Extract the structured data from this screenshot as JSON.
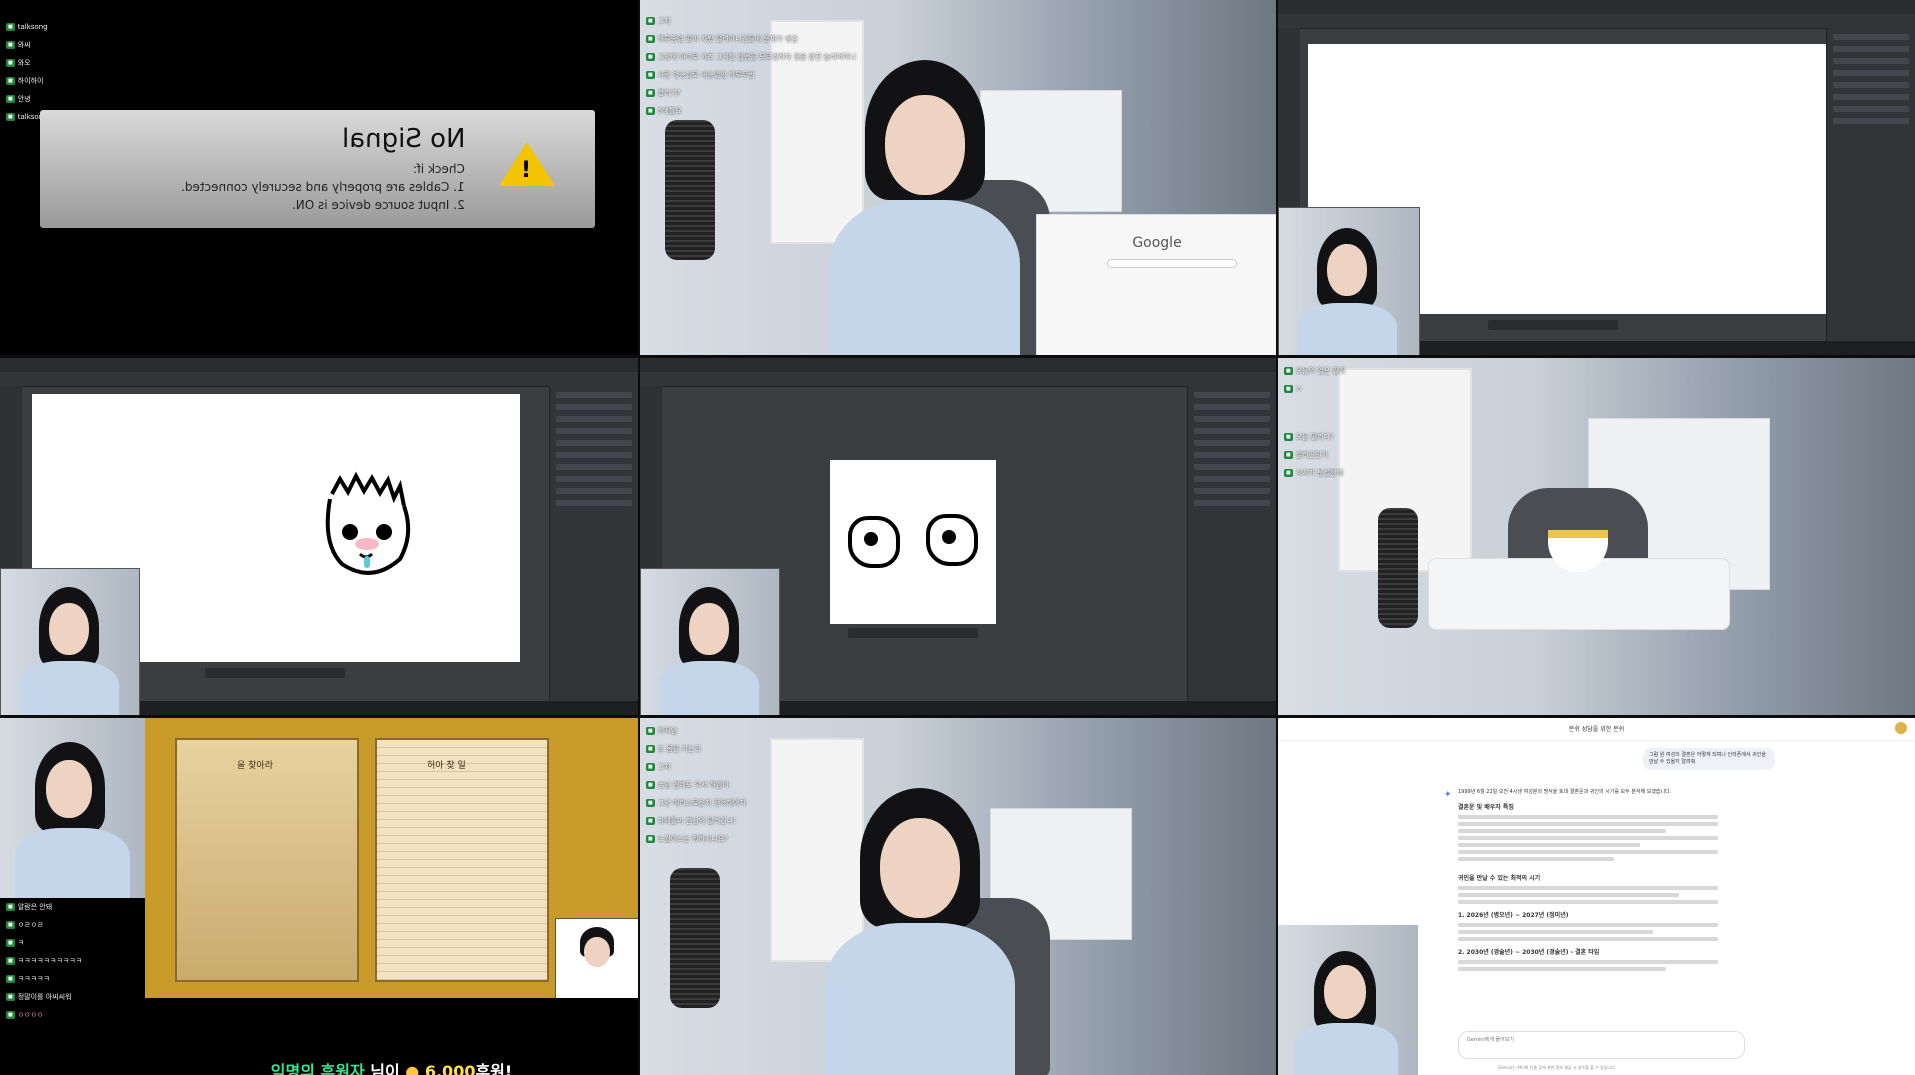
{
  "tile1": {
    "chat": [
      "talksong",
      "와씨",
      "와오",
      "하이하이",
      "안녕",
      "talksong"
    ],
    "no_signal": {
      "title": "No Signal",
      "check": "Check if:",
      "line1": "1. Cables are properly and securely connected.",
      "line2": "2. Input source device is ON."
    }
  },
  "tile2": {
    "chat": [
      "그치",
      "하루종일 딸이 자봤 딸려아니긴들에 둔재가 생김",
      "그냥에 아이로 가즈 그게한 한번을 모르겐하자 정을 완전 놀리어아니",
      "사랑 방송실로 내송일임 하루두번",
      "합리기?",
      "5예월요"
    ],
    "google": "Google"
  },
  "tile7": {
    "chat": [
      "알람은 안돼",
      "ㅇㄹㅇㄹ",
      "ㅋ",
      "ㅋㅋㅋㅋㅋㅋㅋㅋㅋㅋ",
      "ㅋㅋㅋㅋㅋ",
      "정말이를 아씨씨워",
      "ㅇㅇㅇㅇ"
    ],
    "donation": {
      "prefix": "익명의 후원자",
      "mid": "님이",
      "amount": "6,000",
      "suffix": "후원!"
    },
    "book_left_title": "을 찾아라",
    "book_right_title": "허아 찾 일"
  },
  "tile6": {
    "chat": [
      "오늘의 일은 필쥐",
      "ㅇ",
      "오늘 딸리다?",
      "셀리긴인가",
      "식사가 분실한데"
    ]
  },
  "tile8": {
    "chat": [
      "회작임",
      "또 몸을 키는것",
      "그치",
      "손님 엔메도 우서 하임이",
      "그냥 예라스로운지 전육해야지",
      "파에올씨 한선의 달리긴나!",
      "노월이스는 뭐하시나요?"
    ]
  },
  "tile9": {
    "title": "몬쉬 성담을 위한 몬쉬",
    "user_bubble": "그럼 원 여성의 결혼은 어떻게 되며나 인라폰에서 귀인을 만날 수 있을지 알려줘",
    "intro": "1999년 6월 22일 오전 4시생 여성분의 명식을 토대 결혼운과 귀인의 시기를 모두 분석해 보겠습니다.",
    "section1": "결혼운 및 배우자 특징",
    "section2": "귀인을 만날 수 있는 최적의 시기",
    "sub1": "1. 2026년 (병오년) ~ 2027년 (정미년)",
    "sub2": "2. 2030년 (경술년) ~ 2030년 (경술년) - 결혼 타임",
    "input_placeholder": "Gemini에게 물어보기",
    "footer": "Gemini는 AI이며 인물 등에 관한 정보 제공 시 실수를 할 수 있습니다."
  },
  "colors": {
    "chat_tag": "#1b8b3a",
    "warning": "#f5c400",
    "donation_highlight": "#35e38b",
    "donation_amount": "#ffe04a"
  }
}
